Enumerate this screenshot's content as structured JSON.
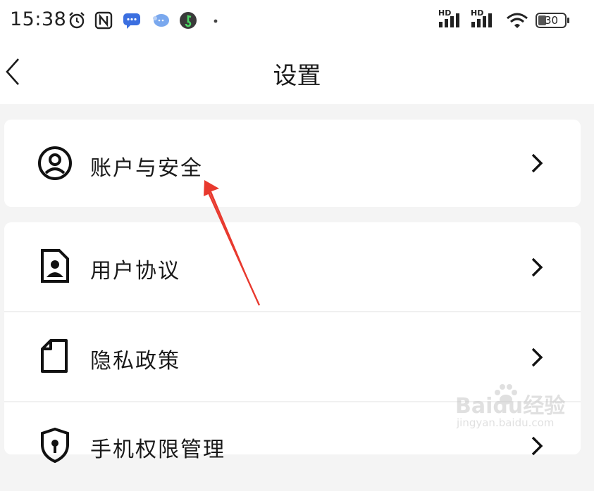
{
  "status_bar": {
    "time": "15:38",
    "battery": "30",
    "signal_1_label": "HD",
    "signal_2_label": "HD"
  },
  "nav": {
    "title": "设置"
  },
  "settings": {
    "items": [
      {
        "label": "账户与安全",
        "icon": "user-circle-icon"
      },
      {
        "label": "用户协议",
        "icon": "user-document-icon"
      },
      {
        "label": "隐私政策",
        "icon": "document-icon"
      },
      {
        "label": "手机权限管理",
        "icon": "shield-lock-icon"
      }
    ]
  },
  "watermark": {
    "main": "Baidu经验",
    "sub": "jingyan.baidu.com"
  },
  "colors": {
    "annotation_arrow": "#e8392e",
    "page_background": "#f4f4f4",
    "card_background": "#ffffff"
  }
}
